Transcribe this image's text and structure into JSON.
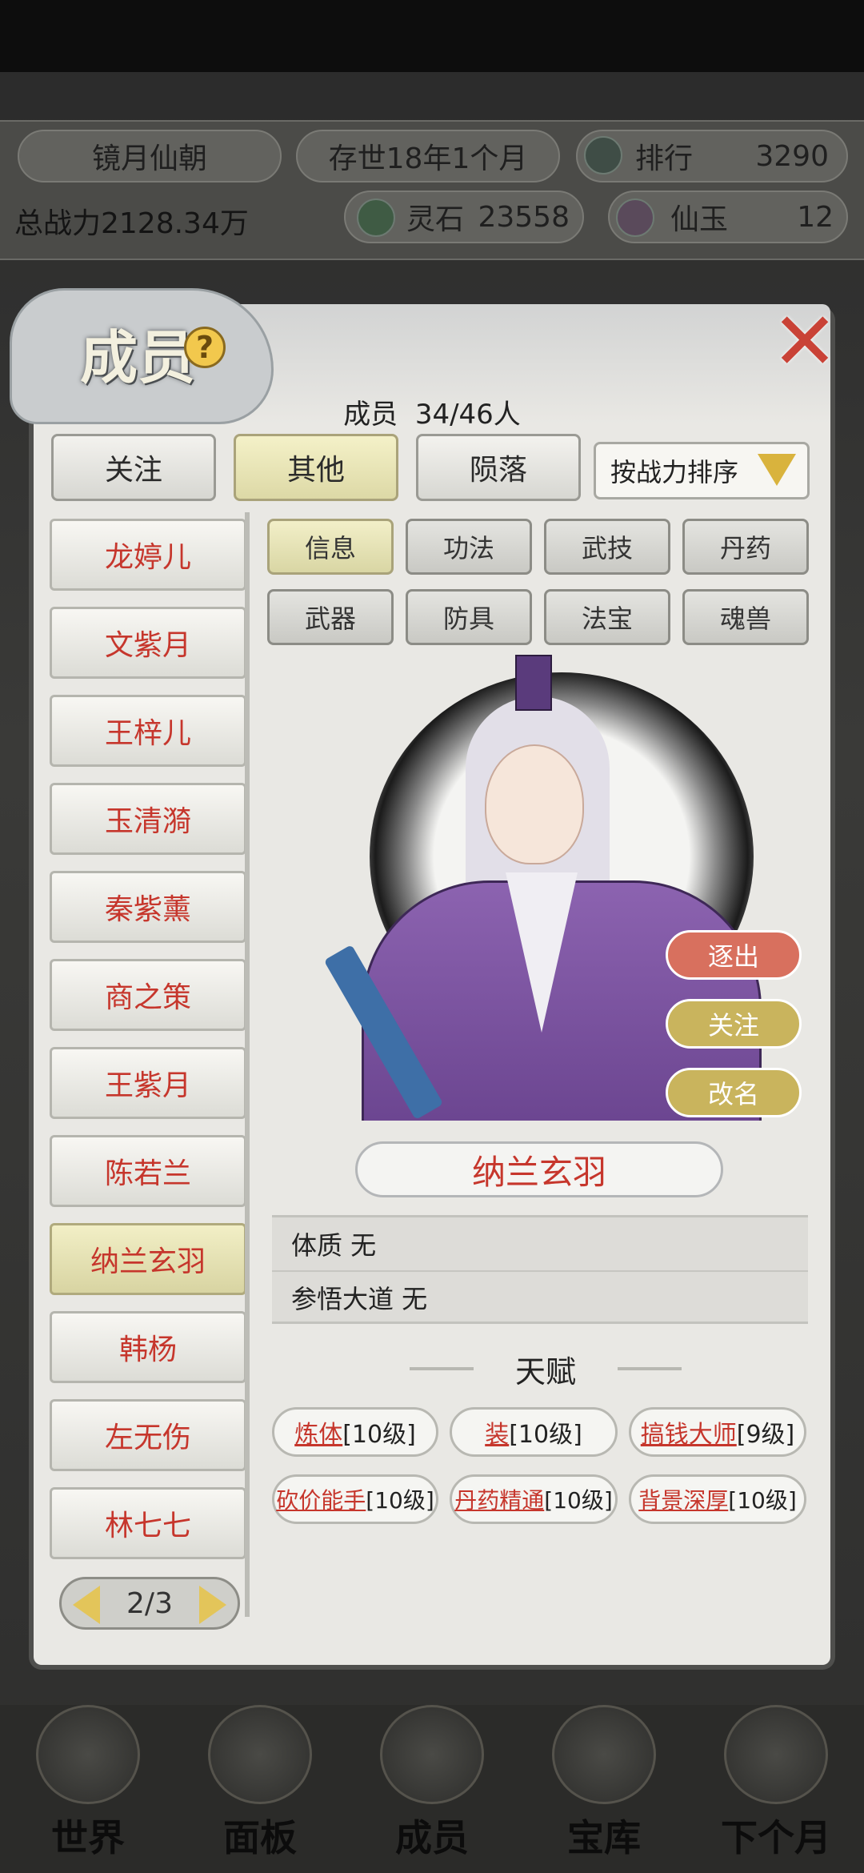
{
  "header": {
    "sect_name": "镜月仙朝",
    "age": "存世18年1个月",
    "rank_label": "排行",
    "rank_value": "3290",
    "power": "总战力2128.34万",
    "spirit_stone_label": "灵石",
    "spirit_stone_value": "23558",
    "jade_label": "仙玉",
    "jade_value": "12"
  },
  "modal": {
    "title": "成员",
    "help": "?",
    "close": "✕",
    "count_label": "成员",
    "count_value": "34/46人",
    "tabs": [
      "关注",
      "其他",
      "陨落"
    ],
    "active_tab": "其他",
    "sort_label": "按战力排序"
  },
  "members": [
    "龙婷儿",
    "文紫月",
    "王梓儿",
    "玉清漪",
    "秦紫薰",
    "商之策",
    "王紫月",
    "陈若兰",
    "纳兰玄羽",
    "韩杨",
    "左无伤",
    "林七七"
  ],
  "selected_member": "纳兰玄羽",
  "pager": "2/3",
  "subtabs": [
    "信息",
    "功法",
    "武技",
    "丹药",
    "武器",
    "防具",
    "法宝",
    "魂兽"
  ],
  "active_subtab": "信息",
  "actions": {
    "expel": "逐出",
    "follow": "关注",
    "rename": "改名"
  },
  "detail": {
    "name": "纳兰玄羽",
    "constitution": "体质 无",
    "dao": "参悟大道 无",
    "talent_header": "天赋",
    "talents": [
      {
        "name": "炼体",
        "level": "[10级]"
      },
      {
        "name": "装",
        "level": "[10级]"
      },
      {
        "name": "搞钱大师",
        "level": "[9级]"
      },
      {
        "name": "砍价能手",
        "level": "[10级]"
      },
      {
        "name": "丹药精通",
        "level": "[10级]"
      },
      {
        "name": "背景深厚",
        "level": "[10级]"
      }
    ]
  },
  "bottom_nav": [
    "世界",
    "面板",
    "成员",
    "宝库",
    "下个月"
  ],
  "colors": {
    "accent_red": "#c6362c",
    "active_tab": "#ddd9a6",
    "expel": "#d8705e",
    "gold": "#d9b33d"
  }
}
